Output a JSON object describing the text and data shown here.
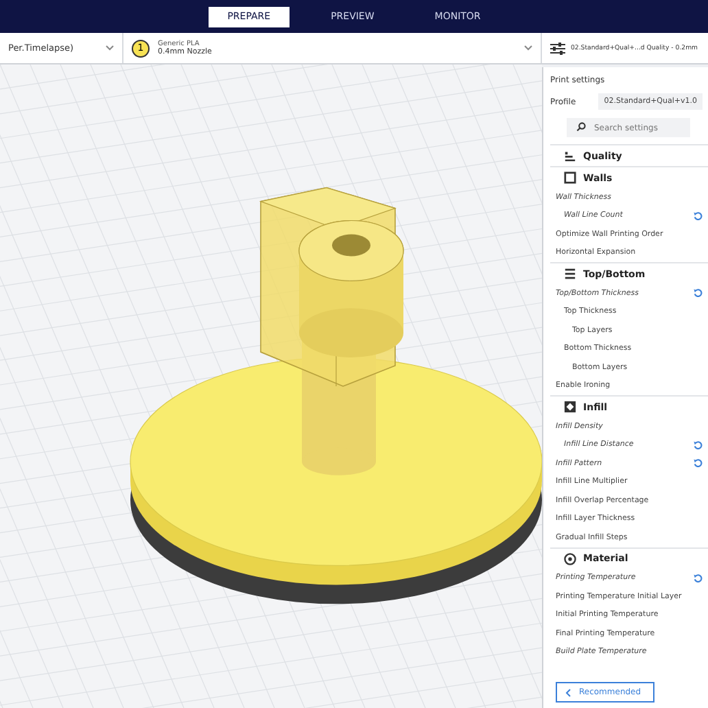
{
  "header": {
    "tabs": [
      {
        "label": "PREPARE",
        "selected": true
      },
      {
        "label": "PREVIEW",
        "selected": false
      },
      {
        "label": "MONITOR",
        "selected": false
      }
    ]
  },
  "toolbar": {
    "printer": "Per.Timelapse)",
    "extruder": {
      "number": "1",
      "material": "Generic PLA",
      "nozzle": "0.4mm Nozzle"
    },
    "profile_summary": "02.Standard+Qual+...d Quality - 0.2mm"
  },
  "print_settings": {
    "title": "Print settings",
    "profile_label": "Profile",
    "profile_value": "02.Standard+Qual+v1.0",
    "search": {
      "placeholder": "Search settings"
    },
    "categories": [
      {
        "name": "Quality"
      },
      {
        "name": "Walls",
        "settings": [
          {
            "label": "Wall Thickness",
            "modified": true,
            "reset": false,
            "children": [
              {
                "label": "Wall Line Count",
                "modified": true,
                "reset": true
              }
            ]
          },
          {
            "label": "Optimize Wall Printing Order",
            "modified": false,
            "reset": false
          },
          {
            "label": "Horizontal Expansion",
            "modified": false,
            "reset": false
          }
        ]
      },
      {
        "name": "Top/Bottom",
        "settings": [
          {
            "label": "Top/Bottom Thickness",
            "modified": true,
            "reset": true,
            "children": [
              {
                "label": "Top Thickness",
                "modified": false,
                "reset": false,
                "children": [
                  {
                    "label": "Top Layers",
                    "modified": false,
                    "reset": false
                  }
                ]
              },
              {
                "label": "Bottom Thickness",
                "modified": false,
                "reset": false,
                "children": [
                  {
                    "label": "Bottom Layers",
                    "modified": false,
                    "reset": false
                  }
                ]
              }
            ]
          },
          {
            "label": "Enable Ironing",
            "modified": false,
            "reset": false
          }
        ]
      },
      {
        "name": "Infill",
        "settings": [
          {
            "label": "Infill Density",
            "modified": true,
            "reset": false,
            "children": [
              {
                "label": "Infill Line Distance",
                "modified": true,
                "reset": true
              }
            ]
          },
          {
            "label": "Infill Pattern",
            "modified": true,
            "reset": true
          },
          {
            "label": "Infill Line Multiplier",
            "modified": false,
            "reset": false
          },
          {
            "label": "Infill Overlap Percentage",
            "modified": false,
            "reset": false
          },
          {
            "label": "Infill Layer Thickness",
            "modified": false,
            "reset": false
          },
          {
            "label": "Gradual Infill Steps",
            "modified": false,
            "reset": false
          }
        ]
      },
      {
        "name": "Material",
        "settings": [
          {
            "label": "Printing Temperature",
            "modified": true,
            "reset": true
          },
          {
            "label": "Printing Temperature Initial Layer",
            "modified": false,
            "reset": false
          },
          {
            "label": "Initial Printing Temperature",
            "modified": false,
            "reset": false
          },
          {
            "label": "Final Printing Temperature",
            "modified": false,
            "reset": false
          },
          {
            "label": "Build Plate Temperature",
            "modified": true,
            "reset": false
          }
        ]
      }
    ],
    "mode_button": "Recommended"
  }
}
